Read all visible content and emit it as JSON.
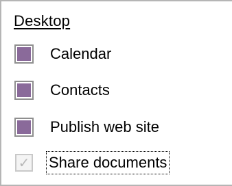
{
  "group": {
    "title": "Desktop"
  },
  "items": [
    {
      "label": "Calendar",
      "state": "indeterminate"
    },
    {
      "label": "Contacts",
      "state": "indeterminate"
    },
    {
      "label": "Publish web site",
      "state": "indeterminate"
    },
    {
      "label": "Share documents",
      "state": "checked-disabled",
      "focused": true
    }
  ],
  "icons": {
    "check": "✓"
  },
  "colors": {
    "indeterminate_fill": "#8a6a9a",
    "disabled_check": "#b7b7b7"
  }
}
